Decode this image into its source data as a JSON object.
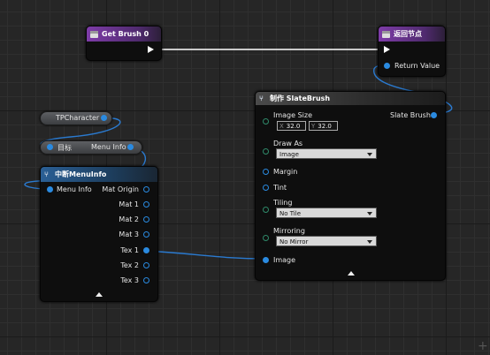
{
  "nodes": {
    "get_brush": {
      "title": "Get Brush 0"
    },
    "return_node": {
      "title": "返回节点",
      "pin_return": "Return Value"
    },
    "tp_character": {
      "title": "TPCharacter"
    },
    "menu_info_getter": {
      "target_label": "目标",
      "output_label": "Menu Info"
    },
    "break_menu_info": {
      "title": "中断MenuInfo",
      "input_label": "Menu Info",
      "outputs": [
        "Mat Origin",
        "Mat 1",
        "Mat 2",
        "Mat 3",
        "Tex 1",
        "Tex 2",
        "Tex 3"
      ]
    },
    "make_slate_brush": {
      "title": "制作 SlateBrush",
      "output_label": "Slate Brush",
      "image_size_label": "Image Size",
      "image_size_x_axis": "X",
      "image_size_x": "32.0",
      "image_size_y_axis": "Y",
      "image_size_y": "32.0",
      "draw_as_label": "Draw As",
      "draw_as_value": "Image",
      "margin_label": "Margin",
      "tint_label": "Tint",
      "tiling_label": "Tiling",
      "tiling_value": "No Tile",
      "mirroring_label": "Mirroring",
      "mirroring_value": "No Mirror",
      "image_label": "Image"
    }
  },
  "colors": {
    "function_header": "#7e3ca8",
    "struct_header": "#2a5f95",
    "object_pin": "#2a8ae0",
    "exec_pin": "#ffffff"
  },
  "corner_text": "+"
}
